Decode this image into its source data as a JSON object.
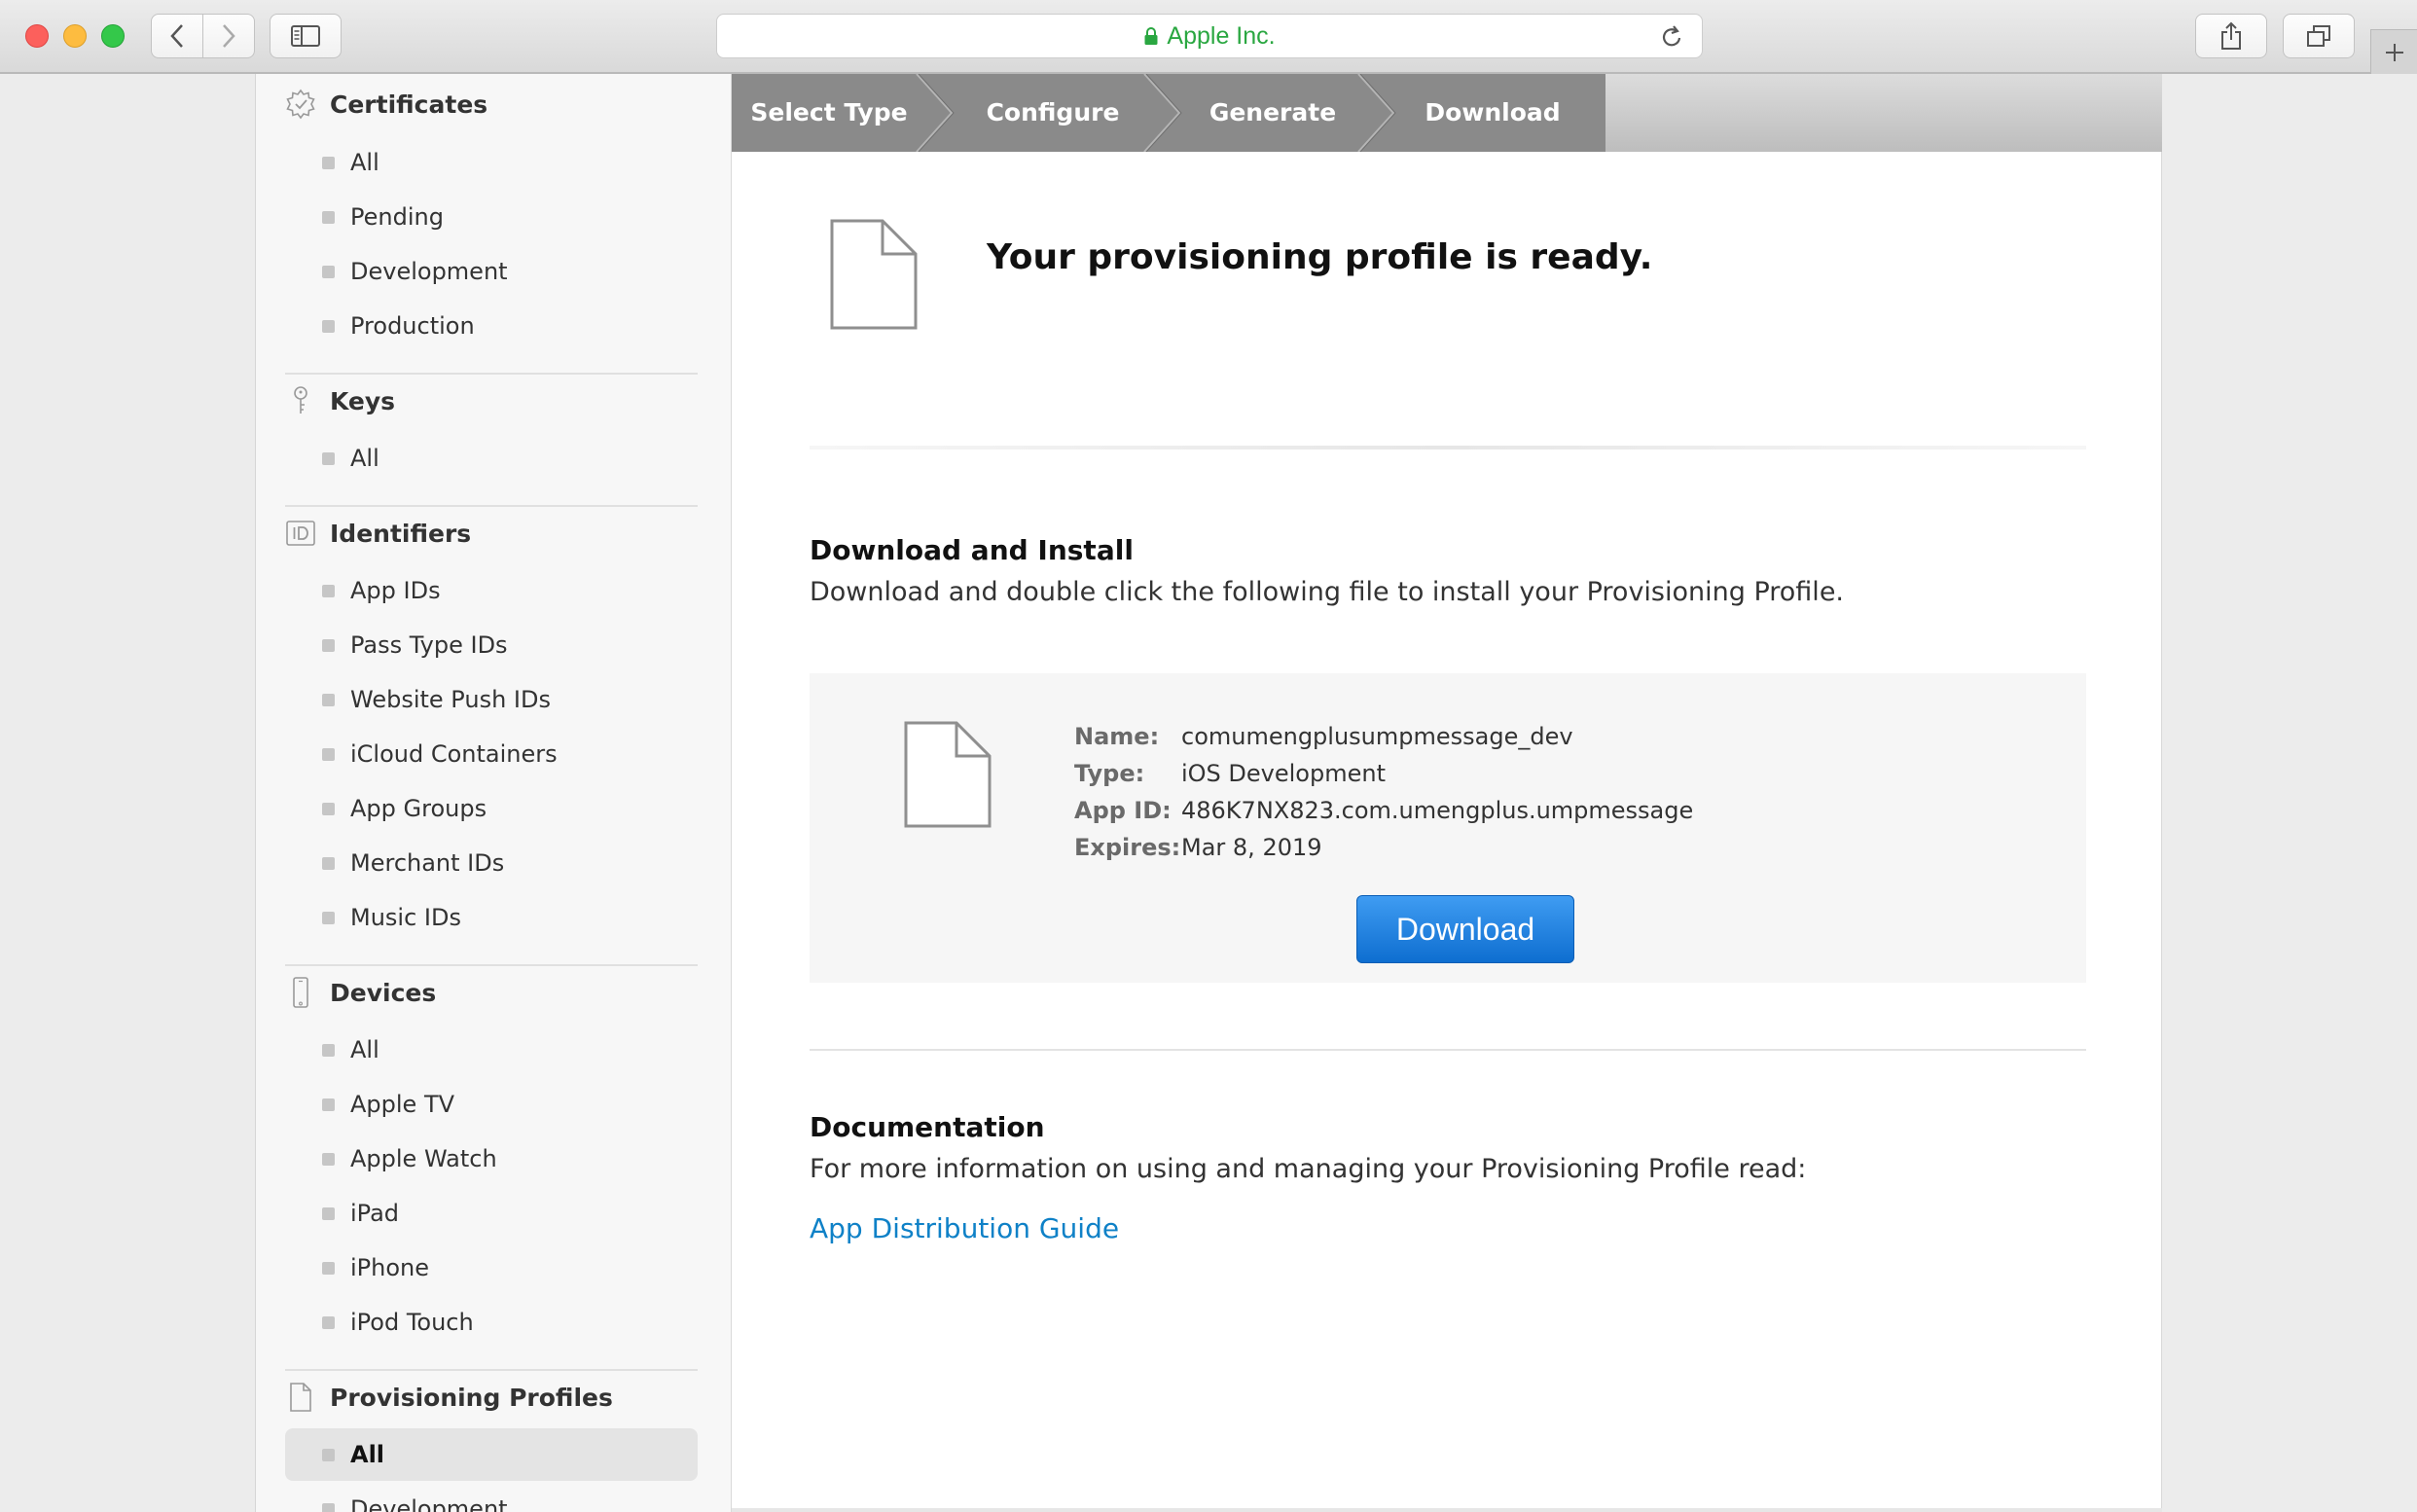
{
  "browser": {
    "address": "Apple Inc.",
    "address_color": "#2aa741"
  },
  "sidebar": {
    "sections": [
      {
        "title": "Certificates",
        "icon": "certificate-icon",
        "items": [
          "All",
          "Pending",
          "Development",
          "Production"
        ]
      },
      {
        "title": "Keys",
        "icon": "key-icon",
        "items": [
          "All"
        ]
      },
      {
        "title": "Identifiers",
        "icon": "id-icon",
        "items": [
          "App IDs",
          "Pass Type IDs",
          "Website Push IDs",
          "iCloud Containers",
          "App Groups",
          "Merchant IDs",
          "Music IDs"
        ]
      },
      {
        "title": "Devices",
        "icon": "device-icon",
        "items": [
          "All",
          "Apple TV",
          "Apple Watch",
          "iPad",
          "iPhone",
          "iPod Touch"
        ]
      },
      {
        "title": "Provisioning Profiles",
        "icon": "document-icon",
        "items": [
          "All",
          "Development"
        ],
        "selected": "All"
      }
    ]
  },
  "steps": [
    "Select Type",
    "Configure",
    "Generate",
    "Download"
  ],
  "main": {
    "title": "Your provisioning profile is ready.",
    "download_heading": "Download and Install",
    "download_text": "Download and double click the following file to install your Provisioning Profile.",
    "profile": {
      "name_label": "Name:",
      "name": "comumengplusumpmessage_dev",
      "type_label": "Type:",
      "type": "iOS Development",
      "appid_label": "App ID:",
      "appid": "486K7NX823.com.umengplus.umpmessage",
      "expires_label": "Expires:",
      "expires": "Mar 8, 2019"
    },
    "download_button": "Download",
    "doc_heading": "Documentation",
    "doc_text": "For more information on using and managing your Provisioning Profile read:",
    "doc_link": "App Distribution Guide"
  },
  "colors": {
    "accent": "#0f81c7",
    "button": "#1a7ad9",
    "step_active": "#8b8b8b"
  }
}
